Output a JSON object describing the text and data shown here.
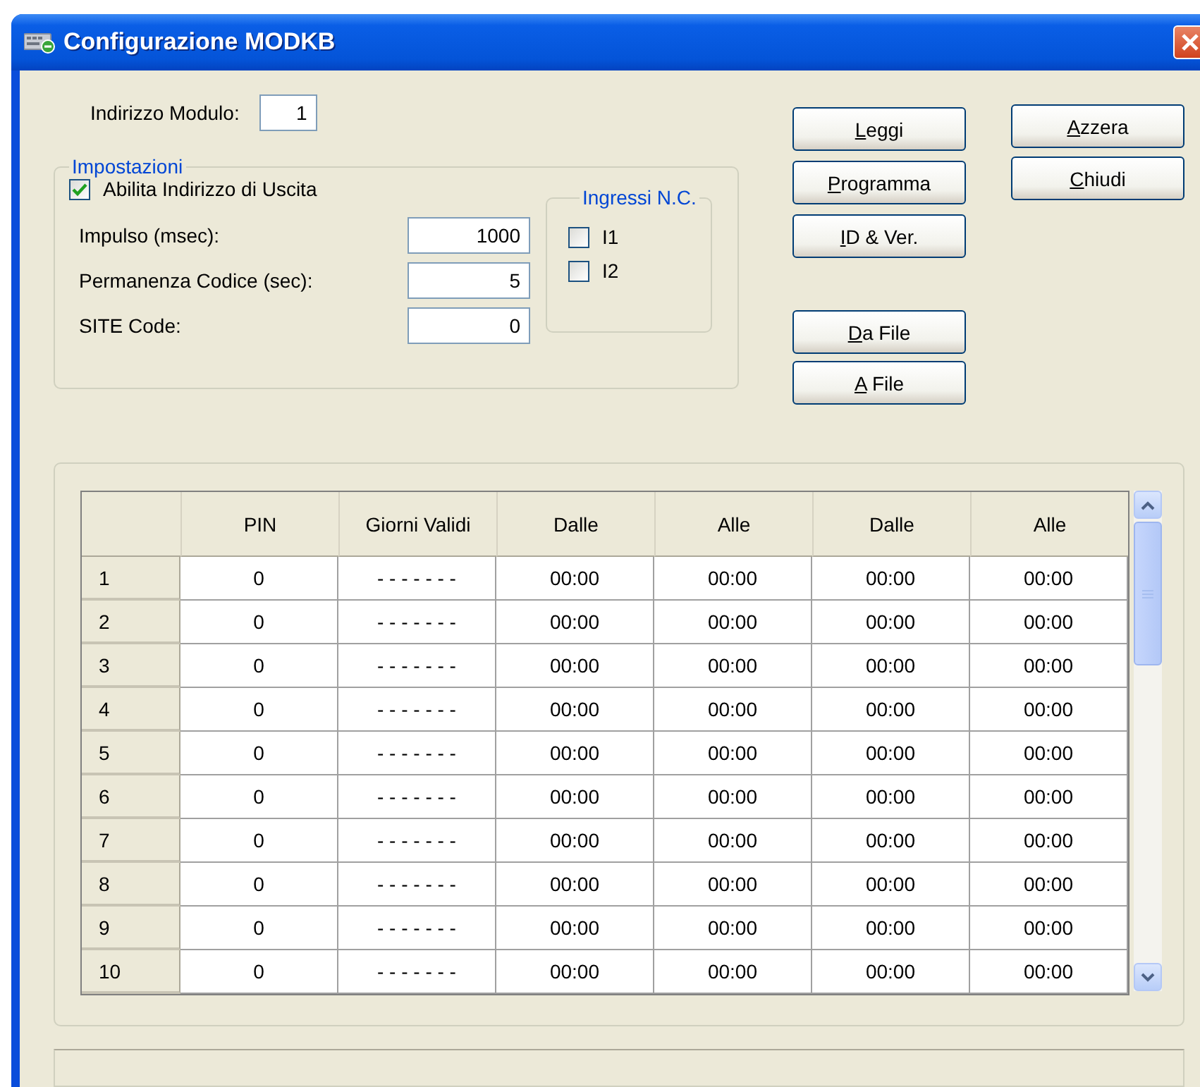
{
  "window": {
    "title": "Configurazione MODKB"
  },
  "module_address": {
    "label": "Indirizzo Modulo:",
    "value": "1"
  },
  "settings": {
    "title": "Impostazioni",
    "enable_output": {
      "label": "Abilita Indirizzo di Uscita",
      "checked": true
    },
    "fields": [
      {
        "label": "Impulso (msec):",
        "value": "1000"
      },
      {
        "label": "Permanenza Codice (sec):",
        "value": "5"
      },
      {
        "label": "SITE Code:",
        "value": "0"
      }
    ]
  },
  "inputs_nc": {
    "title": "Ingressi N.C.",
    "items": [
      {
        "label": "I1",
        "checked": false
      },
      {
        "label": "I2",
        "checked": false
      }
    ]
  },
  "buttons_main": [
    {
      "label": "Leggi",
      "underline_first": true
    },
    {
      "label": "Programma",
      "underline_first": true
    },
    {
      "label": "ID & Ver.",
      "underline_first": true
    }
  ],
  "buttons_file": [
    {
      "label": "Da File",
      "underline_first": true
    },
    {
      "label": "A File",
      "underline_first": true
    }
  ],
  "buttons_side": [
    {
      "label": "Azzera",
      "underline_first": true
    },
    {
      "label": "Chiudi",
      "underline_first": true
    }
  ],
  "table": {
    "columns": [
      "PIN",
      "Giorni Validi",
      "Dalle",
      "Alle",
      "Dalle",
      "Alle"
    ],
    "rows": [
      {
        "header": "1",
        "cells": [
          "0",
          "- - - - - - -",
          "00:00",
          "00:00",
          "00:00",
          "00:00"
        ]
      },
      {
        "header": "2",
        "cells": [
          "0",
          "- - - - - - -",
          "00:00",
          "00:00",
          "00:00",
          "00:00"
        ]
      },
      {
        "header": "3",
        "cells": [
          "0",
          "- - - - - - -",
          "00:00",
          "00:00",
          "00:00",
          "00:00"
        ]
      },
      {
        "header": "4",
        "cells": [
          "0",
          "- - - - - - -",
          "00:00",
          "00:00",
          "00:00",
          "00:00"
        ]
      },
      {
        "header": "5",
        "cells": [
          "0",
          "- - - - - - -",
          "00:00",
          "00:00",
          "00:00",
          "00:00"
        ]
      },
      {
        "header": "6",
        "cells": [
          "0",
          "- - - - - - -",
          "00:00",
          "00:00",
          "00:00",
          "00:00"
        ]
      },
      {
        "header": "7",
        "cells": [
          "0",
          "- - - - - - -",
          "00:00",
          "00:00",
          "00:00",
          "00:00"
        ]
      },
      {
        "header": "8",
        "cells": [
          "0",
          "- - - - - - -",
          "00:00",
          "00:00",
          "00:00",
          "00:00"
        ]
      },
      {
        "header": "9",
        "cells": [
          "0",
          "- - - - - - -",
          "00:00",
          "00:00",
          "00:00",
          "00:00"
        ]
      },
      {
        "header": "10",
        "cells": [
          "0",
          "- - - - - - -",
          "00:00",
          "00:00",
          "00:00",
          "00:00"
        ]
      }
    ]
  }
}
